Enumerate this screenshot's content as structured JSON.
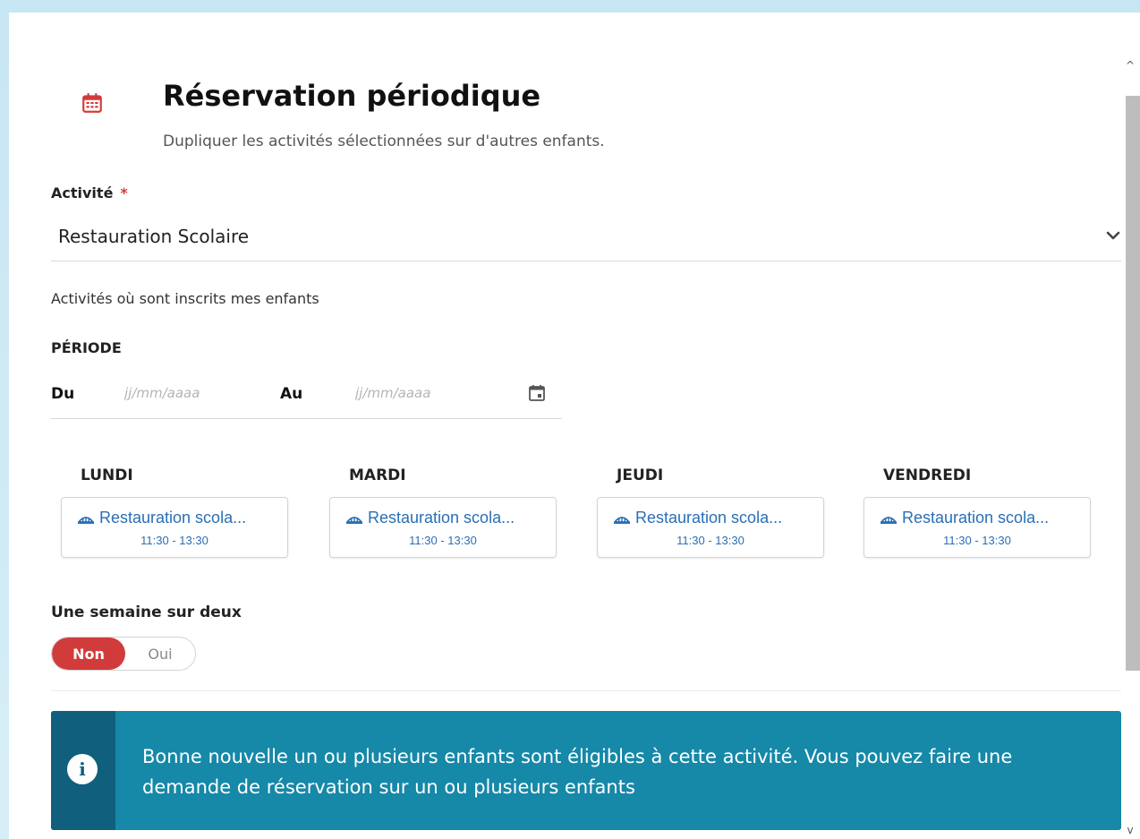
{
  "header": {
    "title": "Réservation périodique",
    "subtitle": "Dupliquer les activités sélectionnées sur d'autres enfants."
  },
  "activity": {
    "label": "Activité",
    "required_mark": "*",
    "value": "Restauration Scolaire",
    "hint": "Activités où sont inscrits mes enfants"
  },
  "period": {
    "section_label": "PÉRIODE",
    "from_label": "Du",
    "from_placeholder": "jj/mm/aaaa",
    "to_label": "Au",
    "to_placeholder": "jj/mm/aaaa"
  },
  "days": [
    {
      "name": "LUNDI",
      "activity": "Restauration scola...",
      "time": "11:30 - 13:30"
    },
    {
      "name": "MARDI",
      "activity": "Restauration scola...",
      "time": "11:30 - 13:30"
    },
    {
      "name": "JEUDI",
      "activity": "Restauration scola...",
      "time": "11:30 - 13:30"
    },
    {
      "name": "VENDREDI",
      "activity": "Restauration scola...",
      "time": "11:30 - 13:30"
    }
  ],
  "alternate_week": {
    "label": "Une semaine sur deux",
    "options": [
      "Non",
      "Oui"
    ],
    "selected": "Non"
  },
  "info": {
    "text": "Bonne nouvelle un ou plusieurs enfants sont éligibles à cette activité. Vous pouvez faire une demande de réservation sur un ou plusieurs enfants",
    "icon_glyph": "i"
  },
  "scrollbar": {
    "up_glyph": "^",
    "down_glyph": "v"
  },
  "colors": {
    "accent_red": "#d23b3b",
    "link_blue": "#2a6fb5",
    "info_bg": "#1688a8",
    "info_strip": "#0f5f7d"
  }
}
